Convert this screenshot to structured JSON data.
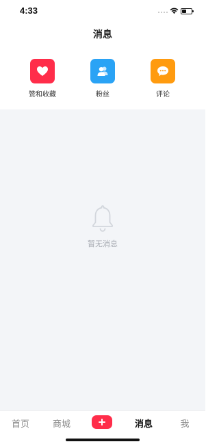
{
  "status_bar": {
    "time": "4:33",
    "battery_level": 0.45,
    "wifi_icon": "wifi-icon",
    "battery_icon": "battery-icon"
  },
  "header": {
    "title": "消息"
  },
  "categories": [
    {
      "label": "赞和收藏",
      "icon": "heart-icon",
      "color": "#ff2d4a"
    },
    {
      "label": "粉丝",
      "icon": "users-icon",
      "color": "#2aa3f5"
    },
    {
      "label": "评论",
      "icon": "comment-icon",
      "color": "#ff9b0f"
    }
  ],
  "empty_state": {
    "icon": "bell-icon",
    "text": "暂无消息"
  },
  "tab_bar": {
    "tabs": [
      {
        "label": "首页",
        "active": false
      },
      {
        "label": "商城",
        "active": false
      },
      {
        "label": "消息",
        "active": true
      },
      {
        "label": "我",
        "active": false
      }
    ],
    "publish_icon": "plus-icon",
    "publish_color": "#ff2d4a"
  },
  "colors": {
    "background": "#f3f5f8",
    "active_tab": "#111111",
    "inactive_tab": "#8a8a8a",
    "empty_text": "#a8acb3"
  }
}
